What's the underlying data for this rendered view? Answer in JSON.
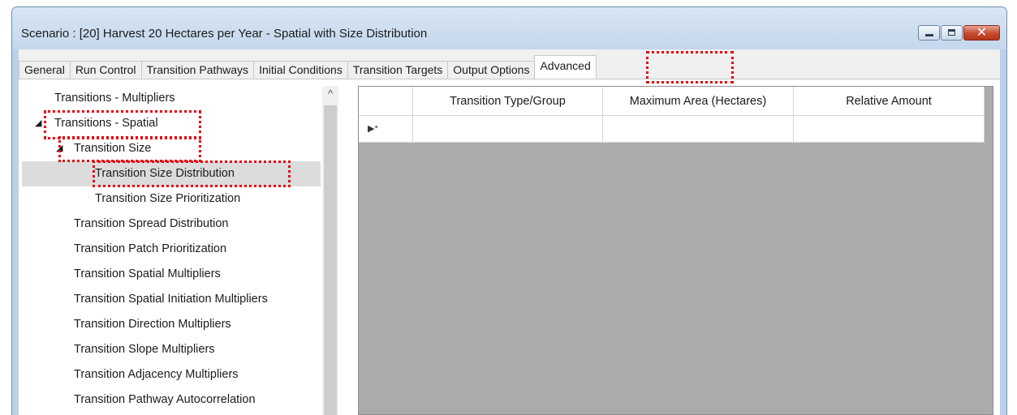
{
  "window": {
    "title": "Scenario : [20] Harvest 20 Hectares per Year - Spatial with Size Distribution",
    "controls": {
      "minimize_icon": "minimize-icon",
      "maximize_icon": "maximize-icon",
      "close_glyph": "✕"
    }
  },
  "tabs": [
    {
      "label": "General"
    },
    {
      "label": "Run Control"
    },
    {
      "label": "Transition Pathways"
    },
    {
      "label": "Initial Conditions"
    },
    {
      "label": "Transition Targets"
    },
    {
      "label": "Output Options"
    },
    {
      "label": "Advanced",
      "active": true
    }
  ],
  "tree": {
    "items": [
      {
        "label": "Transitions - Multipliers"
      },
      {
        "label": "Transitions - Spatial",
        "expander": "◢"
      },
      {
        "label": "Transition Size",
        "expander": "◢"
      },
      {
        "label": "Transition Size Distribution",
        "selected": true
      },
      {
        "label": "Transition Size Prioritization"
      },
      {
        "label": "Transition Spread Distribution"
      },
      {
        "label": "Transition Patch Prioritization"
      },
      {
        "label": "Transition Spatial Multipliers"
      },
      {
        "label": "Transition Spatial Initiation Multipliers"
      },
      {
        "label": "Transition Direction Multipliers"
      },
      {
        "label": "Transition Slope Multipliers"
      },
      {
        "label": "Transition Adjacency Multipliers"
      },
      {
        "label": "Transition Pathway Autocorrelation"
      }
    ],
    "scroll_up_glyph": "^"
  },
  "grid": {
    "columns": [
      "",
      "Transition Type/Group",
      "Maximum Area (Hectares)",
      "Relative Amount"
    ],
    "new_row_indicator": "▶*"
  },
  "colors": {
    "highlight": "#e8000c",
    "window_frame": "#b9d1ea",
    "grid_background": "#ababab",
    "selected_row": "#dcdcdc"
  }
}
